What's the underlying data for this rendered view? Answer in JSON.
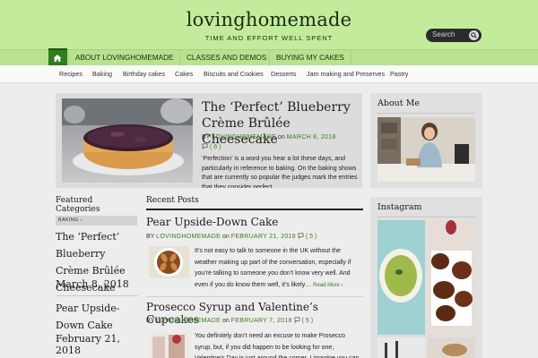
{
  "site": {
    "title": "lovinghomemade",
    "tagline": "TIME AND EFFORT WELL SPENT"
  },
  "search": {
    "placeholder": "Search"
  },
  "primary_nav": [
    "ABOUT LOVINGHOMEMADE",
    "CLASSES AND DEMOS",
    "BUYING MY CAKES"
  ],
  "secondary_nav": [
    "Recipes",
    "Baking",
    "Birthday cakes",
    "Cakes",
    "Biscuits and Cookies",
    "Desserts",
    "Jam making and Preserves",
    "Pastry"
  ],
  "featured": {
    "title": "The ‘Perfect’ Blueberry Crème Brûlée Cheesecake",
    "by": "BY",
    "author": "LOVINGHOMEMADE",
    "on": "on",
    "date": "MARCH 8, 2018",
    "comments": "( 6 )",
    "excerpt": "‘Perfection’ is a word you hear a lot these days, and particularly in reference to baking. On the baking shows that are currently so popular the judges mark the entries that they consider perfect"
  },
  "featured_categories": {
    "heading": "Featured Categories",
    "tag": "BAKING ›",
    "items": [
      {
        "title": "The ‘Perfect’ Blueberry Crème Brûlée Cheesecake",
        "date": "March 8, 2018"
      },
      {
        "title": "Pear Upside-Down Cake",
        "date": "February 21, 2018"
      }
    ]
  },
  "recent_posts": {
    "heading": "Recent Posts",
    "posts": [
      {
        "title": "Pear Upside-Down Cake",
        "by": "BY",
        "author": "LOVINGHOMEMADE",
        "on": "on",
        "date": "FEBRUARY 21, 2018",
        "comments": "( 5 )",
        "excerpt": "It’s not easy to talk to someone in the UK without the weather making up part of the conversation, especially if you’re talking to someone you don’t know very well. And even if you do know them well, it’s likely…",
        "read_more": "Read More ›"
      },
      {
        "title": "Prosecco Syrup and Valentine’s Cupcakes",
        "by": "BY",
        "author": "LOVINGHOMEMADE",
        "on": "on",
        "date": "FEBRUARY 7, 2018",
        "comments": "( 5 )",
        "excerpt": "You definitely don’t need an excuse to make Prosecco syrup, but, if you did happen to be looking for one, Valentine’s Day is just around the corner. I imagine you can"
      }
    ]
  },
  "sidebar": {
    "about_title": "About Me",
    "instagram_title": "Instagram"
  },
  "colors": {
    "header_bg": "#c2ec9c",
    "nav_bg": "#b8e28f",
    "accent_green": "#3a7d1f",
    "home_active": "#2e7d1f"
  }
}
